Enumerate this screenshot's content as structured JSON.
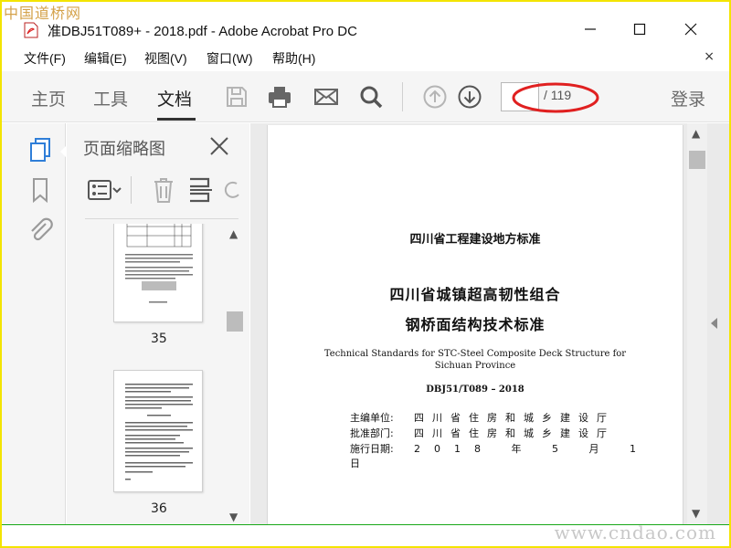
{
  "watermarks": {
    "top": "中国道桥网",
    "bottom": "www.cndao.com"
  },
  "window": {
    "title": "准DBJ51T089+ - 2018.pdf - Adobe Acrobat Pro DC"
  },
  "menu": {
    "items": [
      "文件(F)",
      "编辑(E)",
      "视图(V)",
      "窗口(W)",
      "帮助(H)"
    ],
    "close": "×"
  },
  "toolbar": {
    "tabs": {
      "home": "主页",
      "tools": "工具",
      "document": "文档"
    },
    "page_input": "",
    "page_total": "/ 119",
    "login": "登录",
    "icons": [
      "save-icon",
      "print-icon",
      "email-icon",
      "search-icon",
      "prev-page-icon",
      "next-page-icon"
    ]
  },
  "rail": {
    "icons": [
      "page-thumbnails-icon",
      "bookmark-icon",
      "attachment-icon"
    ],
    "accent": "#2f7ed8"
  },
  "panel": {
    "title": "页面缩略图",
    "thumbnails": [
      {
        "label": "35"
      },
      {
        "label": "36"
      }
    ]
  },
  "document": {
    "header": "四川省工程建设地方标准",
    "title_line1": "四川省城镇超高韧性组合",
    "title_line2": "钢桥面结构技术标准",
    "english_line1": "Technical Standards for STC-Steel Composite Deck Structure for",
    "english_line2": "Sichuan Province",
    "code": "DBJ51/T089 – 2018",
    "rows": [
      {
        "key": "主编单位:",
        "value": "四川省住房和城乡建设厅"
      },
      {
        "key": "批准部门:",
        "value": "四川省住房和城乡建设厅"
      },
      {
        "key": "施行日期:",
        "value": "2018 年 5 月 1 日"
      }
    ]
  },
  "colors": {
    "frame": "#f3e400",
    "annotation": "#e02020",
    "scrollbar": "#bcbcbc"
  }
}
